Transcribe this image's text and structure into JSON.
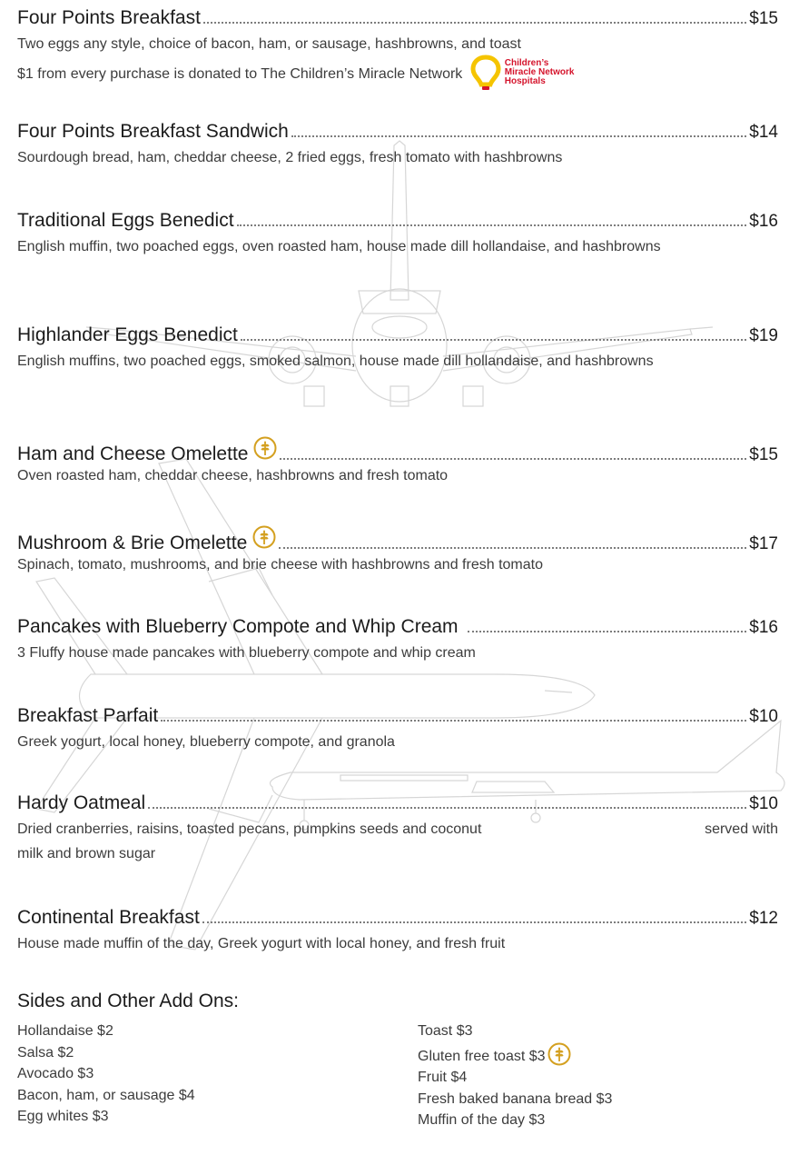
{
  "items": [
    {
      "name": "Four Points Breakfast",
      "price": "$15",
      "gluten_free": false,
      "desc": "Two eggs any style, choice of bacon, ham, or sausage, hashbrowns, and toast",
      "desc2": "$1 from every purchase is donated to The Children’s Miracle Network",
      "logo_text": "Children’s Miracle Network Hospitals"
    },
    {
      "name": "Four Points Breakfast Sandwich",
      "price": "$14",
      "gluten_free": false,
      "desc": "Sourdough bread, ham, cheddar cheese, 2 fried eggs, fresh tomato with hashbrowns"
    },
    {
      "name": "Traditional Eggs Benedict",
      "price": "$16",
      "gluten_free": false,
      "desc": "English muffin, two poached eggs, oven roasted ham, house made dill hollandaise, and hashbrowns"
    },
    {
      "name": "Highlander Eggs Benedict",
      "price": "$19",
      "gluten_free": false,
      "desc": "English muffins, two poached eggs, smoked salmon, house made dill hollandaise, and hashbrowns"
    },
    {
      "name": "Ham and Cheese Omelette",
      "price": "$15",
      "gluten_free": true,
      "desc": "Oven roasted ham, cheddar cheese, hashbrowns and fresh tomato"
    },
    {
      "name": "Mushroom & Brie Omelette",
      "price": "$17",
      "gluten_free": true,
      "desc": "Spinach, tomato, mushrooms, and brie cheese with hashbrowns and fresh tomato"
    },
    {
      "name": "Pancakes with Blueberry Compote and Whip Cream",
      "price": "$16",
      "gluten_free": false,
      "desc": "3 Fluffy house made pancakes with blueberry compote and whip cream"
    },
    {
      "name": "Breakfast Parfait",
      "price": "$10",
      "gluten_free": false,
      "desc": "Greek yogurt, local honey, blueberry compote, and granola"
    },
    {
      "name": "Hardy Oatmeal",
      "price": "$10",
      "gluten_free": false,
      "desc": "Dried cranberries, raisins, toasted pecans, pumpkins seeds and coconut",
      "desc_right": "served with",
      "desc2": "milk and brown sugar"
    },
    {
      "name": "Continental Breakfast",
      "price": "$12",
      "gluten_free": false,
      "desc": "House made muffin of the day, Greek yogurt with local honey, and fresh fruit"
    }
  ],
  "sides": {
    "title": "Sides and Other Add Ons:",
    "left": [
      "Hollandaise $2",
      "Salsa $2",
      "Avocado $3",
      "Bacon, ham, or sausage $4",
      "Egg whites $3"
    ],
    "right": [
      "Toast $3",
      "Gluten free toast $3",
      "Fruit $4",
      "Fresh baked banana bread $3",
      "Muffin of the day $3"
    ],
    "gluten_free_index": 1
  },
  "colors": {
    "text": "#1c1c1c",
    "description": "#3c3c3c",
    "gluten_free_icon": "#d4a020",
    "cmn_yellow": "#f5c400",
    "cmn_red": "#d5142c",
    "watermark": "#d9d9d9"
  },
  "icons": {
    "gluten_free": "wheat-icon",
    "charity": "lightbulb-logo-icon",
    "background": "airplane-watermark"
  }
}
